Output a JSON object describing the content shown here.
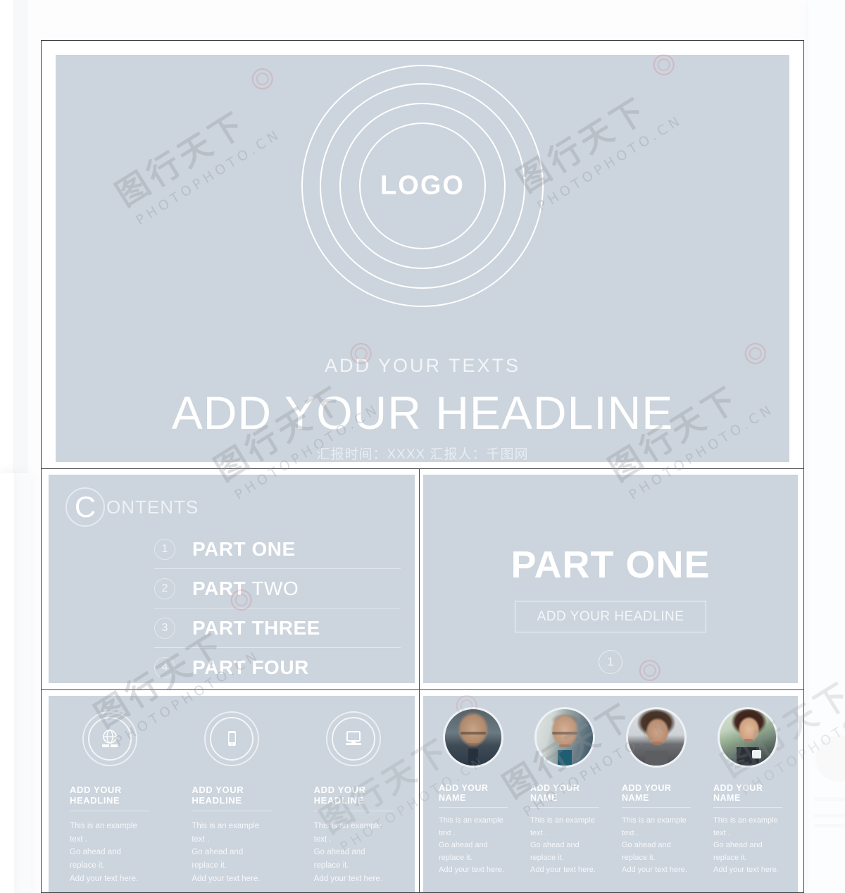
{
  "theme": {
    "slide_bg": "#ccd4dd",
    "frame_border": "#3b3f43",
    "text_white": "#ffffff",
    "page_bg": "#fbfcfd"
  },
  "watermark": {
    "cn_text": "图行天下",
    "en_text": "PHOTOPHOTO.CN"
  },
  "slides": {
    "title_slide": {
      "logo_text": "LOGO",
      "subtitle": "ADD  YOUR TEXTS",
      "headline": "ADD  YOUR HEADLINE",
      "byline": "汇报时间：XXXX  汇报人：千图网"
    },
    "contents_slide": {
      "header_initial": "C",
      "header_rest": "ONTENTS",
      "items": [
        {
          "number": "1",
          "bold_part": "PART",
          "light_part": "ONE",
          "all_bold": true
        },
        {
          "number": "2",
          "bold_part": "PART",
          "light_part": "TWO",
          "all_bold": false
        },
        {
          "number": "3",
          "bold_part": "PART",
          "light_part": "THREE",
          "all_bold": true
        },
        {
          "number": "4",
          "bold_part": "PART",
          "light_part": "FOUR",
          "all_bold": true
        }
      ]
    },
    "part_one_slide": {
      "title": "PART ONE",
      "box_label": "ADD YOUR HEADLINE",
      "number": "1"
    },
    "features_slide": {
      "columns": [
        {
          "icon": "globe-book-icon",
          "heading": "ADD YOUR HEADLINE",
          "body": "This is an example text .\nGo ahead and replace it.\nAdd your text here."
        },
        {
          "icon": "smartphone-icon",
          "heading": "ADD YOUR HEADLINE",
          "body": "This is an example text .\nGo ahead and replace it.\nAdd your text here."
        },
        {
          "icon": "desktop-computer-icon",
          "heading": "ADD YOUR HEADLINE",
          "body": "This is an example text .\nGo ahead and replace it.\nAdd your text here."
        }
      ]
    },
    "team_slide": {
      "members": [
        {
          "photo": "bald-man-in-suit-photo",
          "heading": "ADD YOUR NAME",
          "body": "This is an example text .\nGo ahead and replace it.\nAdd your text here."
        },
        {
          "photo": "man-with-glasses-photo",
          "heading": "ADD YOUR NAME",
          "body": "This is an example text .\nGo ahead and replace it.\nAdd your text here."
        },
        {
          "photo": "woman-dark-hair-photo",
          "heading": "ADD YOUR NAME",
          "body": "This is an example text .\nGo ahead and replace it.\nAdd your text here."
        },
        {
          "photo": "woman-with-cup-photo",
          "heading": "ADD YOUR NAME",
          "body": "This is an example text .\nGo ahead and replace it.\nAdd your text here."
        }
      ]
    }
  }
}
